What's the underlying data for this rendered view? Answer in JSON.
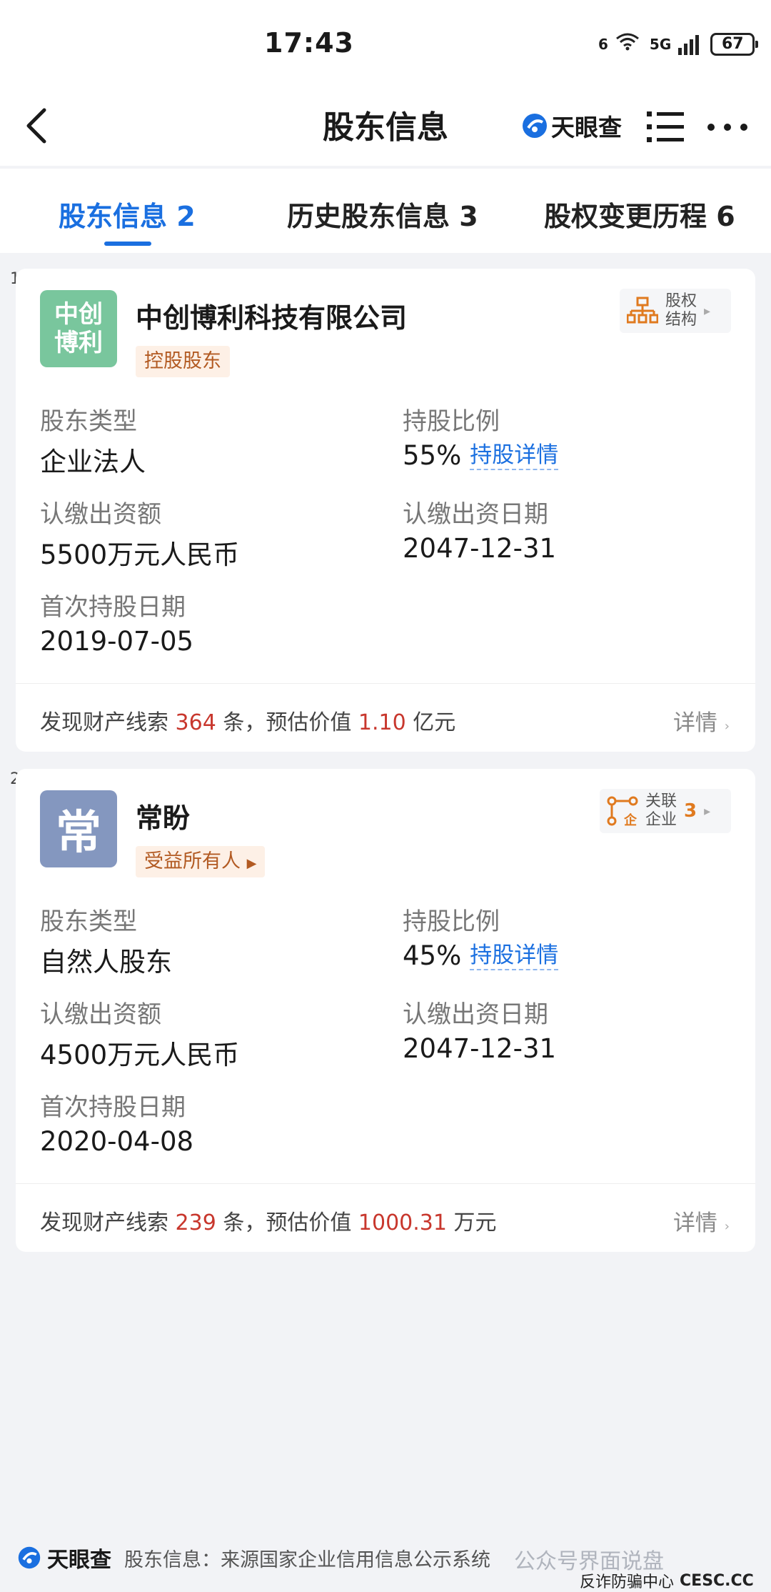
{
  "status_bar": {
    "time": "17:43",
    "network": "5G",
    "wifi_tag": "6",
    "battery": "67"
  },
  "nav": {
    "title": "股东信息",
    "brand": "天眼查"
  },
  "tabs": [
    {
      "label": "股东信息 2",
      "active": true
    },
    {
      "label": "历史股东信息 3",
      "active": false
    },
    {
      "label": "股权变更历程 6",
      "active": false
    }
  ],
  "shareholders": [
    {
      "index": "1",
      "avatar_text": "中创\n博利",
      "avatar_color": "#79c69d",
      "name": "中创博利科技有限公司",
      "tag": "控股股东",
      "side_button": {
        "label_line1": "股权",
        "label_line2": "结构",
        "count": ""
      },
      "type_label": "股东类型",
      "type_value": "企业法人",
      "ratio_label": "持股比例",
      "ratio_value": "55%",
      "ratio_link": "持股详情",
      "capital_label": "认缴出资额",
      "capital_value": "5500万元人民币",
      "date_label": "认缴出资日期",
      "date_value": "2047-12-31",
      "first_label": "首次持股日期",
      "first_value": "2019-07-05",
      "clue_prefix": "发现财产线索 ",
      "clue_count": "364",
      "clue_mid": " 条，预估价值 ",
      "clue_value": "1.10",
      "clue_unit": " 亿元",
      "detail": "详情"
    },
    {
      "index": "2",
      "avatar_text": "常",
      "avatar_color": "#8497bf",
      "name": "常盼",
      "tag": "受益所有人",
      "side_button": {
        "label_line1": "关联",
        "label_line2": "企业",
        "count": "3"
      },
      "type_label": "股东类型",
      "type_value": "自然人股东",
      "ratio_label": "持股比例",
      "ratio_value": "45%",
      "ratio_link": "持股详情",
      "capital_label": "认缴出资额",
      "capital_value": "4500万元人民币",
      "date_label": "认缴出资日期",
      "date_value": "2047-12-31",
      "first_label": "首次持股日期",
      "first_value": "2020-04-08",
      "clue_prefix": "发现财产线索 ",
      "clue_count": "239",
      "clue_mid": " 条，预估价值 ",
      "clue_value": "1000.31",
      "clue_unit": " 万元",
      "detail": "详情"
    }
  ],
  "footer": {
    "brand": "天眼查",
    "source": "股东信息：来源国家企业信用信息公示系统",
    "watermark1": "公众号界面说盘",
    "watermark2": "反诈防骗中心",
    "watermark2_site": "CESC.CC"
  },
  "colors": {
    "accent": "#1a6fe0",
    "highlight": "#c8372d",
    "tag_text": "#b25a22"
  }
}
